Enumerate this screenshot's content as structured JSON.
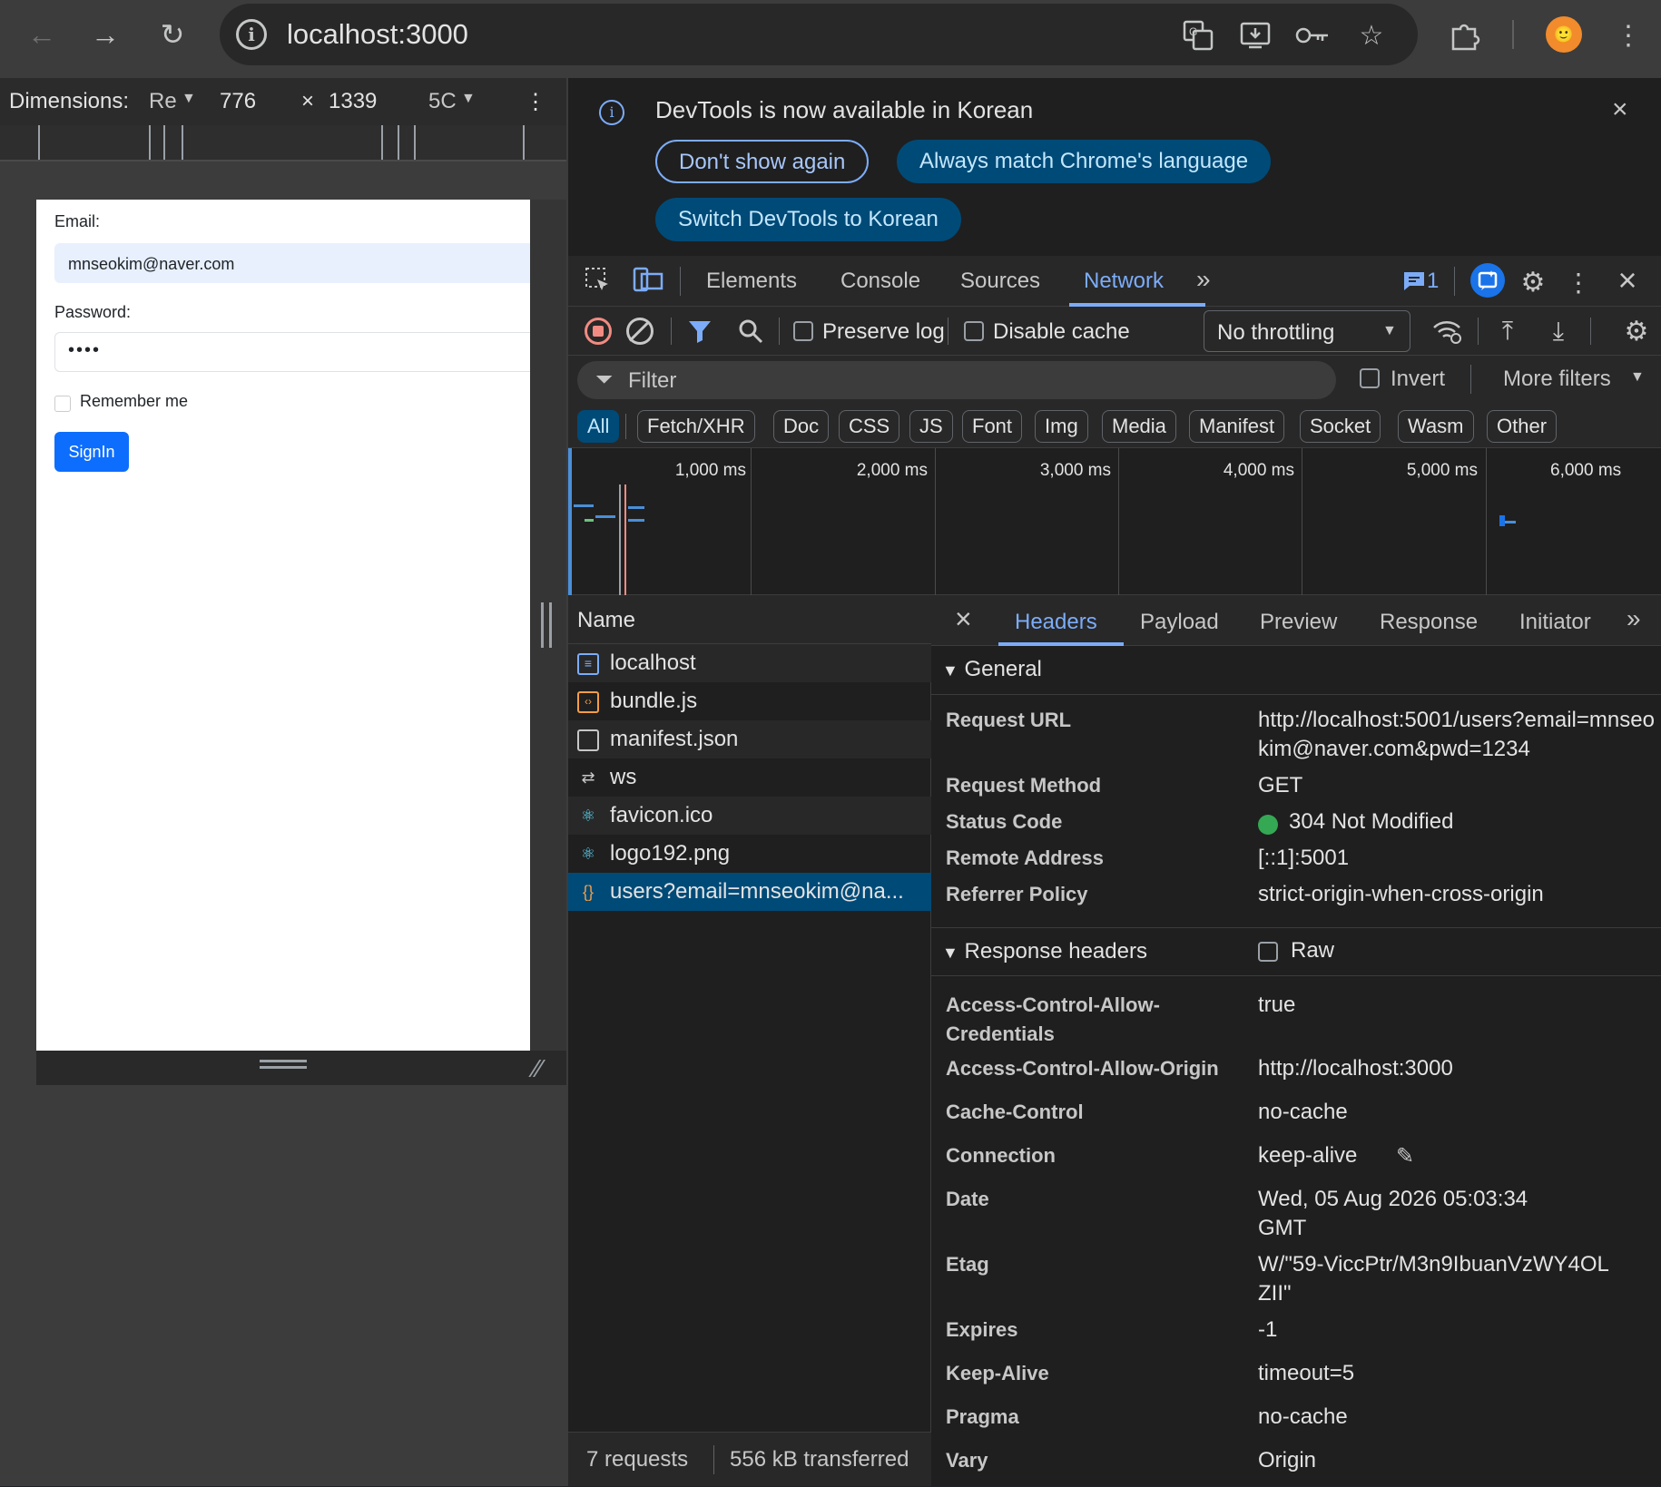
{
  "browser": {
    "url": "localhost:3000",
    "avatar_glyph": "🙂"
  },
  "device_toolbar": {
    "dimensions_label": "Dimensions:",
    "preset": "Re",
    "width": "776",
    "times": "×",
    "height": "1339",
    "zoom": "5C"
  },
  "page": {
    "email_label": "Email:",
    "email_value": "mnseokim@naver.com",
    "password_label": "Password:",
    "password_value": "••••",
    "remember_label": "Remember me",
    "signin_label": "SignIn"
  },
  "infobar": {
    "message": "DevTools is now available in Korean",
    "dont_show": "Don't show again",
    "always_match": "Always match Chrome's language",
    "switch": "Switch DevTools to Korean"
  },
  "tabs": {
    "elements": "Elements",
    "console": "Console",
    "sources": "Sources",
    "network": "Network",
    "issues_count": "1"
  },
  "network_toolbar": {
    "preserve_log": "Preserve log",
    "disable_cache": "Disable cache",
    "throttling": "No throttling"
  },
  "filter": {
    "placeholder": "Filter",
    "invert": "Invert",
    "more_filters": "More filters"
  },
  "types": [
    "All",
    "Fetch/XHR",
    "Doc",
    "CSS",
    "JS",
    "Font",
    "Img",
    "Media",
    "Manifest",
    "Socket",
    "Wasm",
    "Other"
  ],
  "timeline": {
    "labels": [
      "1,000 ms",
      "2,000 ms",
      "3,000 ms",
      "4,000 ms",
      "5,000 ms",
      "6,000 ms"
    ]
  },
  "request_list": {
    "header": "Name",
    "items": [
      "localhost",
      "bundle.js",
      "manifest.json",
      "ws",
      "favicon.ico",
      "logo192.png",
      "users?email=mnseokim@na..."
    ],
    "requests": "7 requests",
    "transferred": "556 kB transferred"
  },
  "detail": {
    "tabs": [
      "Headers",
      "Payload",
      "Preview",
      "Response",
      "Initiator"
    ],
    "general_title": "General",
    "general": [
      {
        "k": "Request URL",
        "v": "http://localhost:5001/users?email=mnseokim@naver.com&pwd=1234"
      },
      {
        "k": "Request Method",
        "v": "GET"
      },
      {
        "k": "Status Code",
        "v": "304 Not Modified"
      },
      {
        "k": "Remote Address",
        "v": "[::1]:5001"
      },
      {
        "k": "Referrer Policy",
        "v": "strict-origin-when-cross-origin"
      }
    ],
    "response_title": "Response headers",
    "raw": "Raw",
    "response": [
      {
        "k": "Access-Control-Allow-Credentials",
        "v": "true"
      },
      {
        "k": "Access-Control-Allow-Origin",
        "v": "http://localhost:3000"
      },
      {
        "k": "Cache-Control",
        "v": "no-cache"
      },
      {
        "k": "Connection",
        "v": "keep-alive"
      },
      {
        "k": "Date",
        "v": "Wed, 05 Aug 2026 05:03:34 GMT"
      },
      {
        "k": "Etag",
        "v": "W/\"59-ViccPtr/M3n9IbuanVzWY4OLZII\""
      },
      {
        "k": "Expires",
        "v": "-1"
      },
      {
        "k": "Keep-Alive",
        "v": "timeout=5"
      },
      {
        "k": "Pragma",
        "v": "no-cache"
      },
      {
        "k": "Vary",
        "v": "Origin"
      }
    ]
  },
  "colors": {
    "accent": "#7cacf8",
    "status_ok": "#34a853",
    "record": "#f28b82"
  }
}
